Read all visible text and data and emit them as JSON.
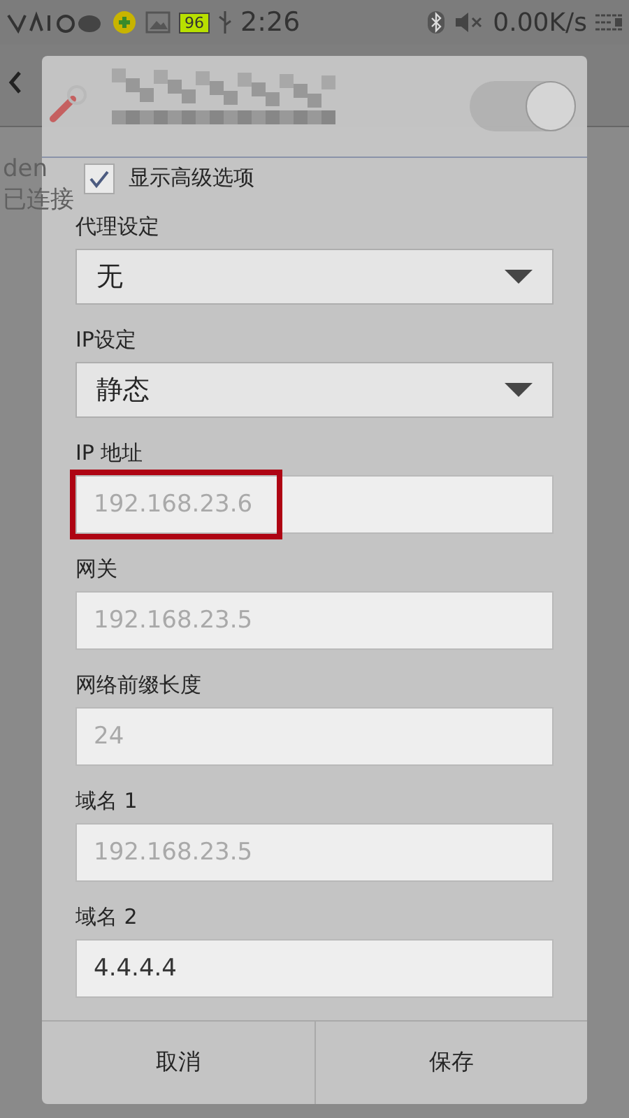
{
  "status_bar": {
    "battery": "96",
    "time": "2:26",
    "speed": "0.00K/s"
  },
  "background": {
    "network_name": "den",
    "network_status": "已连接"
  },
  "dialog": {
    "toggle_on": true,
    "show_advanced": {
      "label": "显示高级选项",
      "checked": true
    },
    "fields": [
      {
        "kind": "select",
        "label": "代理设定",
        "value": "无"
      },
      {
        "kind": "select",
        "label": "IP设定",
        "value": "静态"
      },
      {
        "kind": "input",
        "label": "IP 地址",
        "placeholder": "192.168.23.6",
        "highlighted": true
      },
      {
        "kind": "input",
        "label": "网关",
        "placeholder": "192.168.23.5",
        "highlighted": false
      },
      {
        "kind": "input",
        "label": "网络前缀长度",
        "placeholder": "24",
        "highlighted": false
      },
      {
        "kind": "input",
        "label": "域名 1",
        "placeholder": "192.168.23.5",
        "highlighted": false
      },
      {
        "kind": "input",
        "label": "域名 2",
        "value": "4.4.4.4",
        "highlighted": false
      }
    ],
    "buttons": [
      "取消",
      "保存"
    ]
  }
}
